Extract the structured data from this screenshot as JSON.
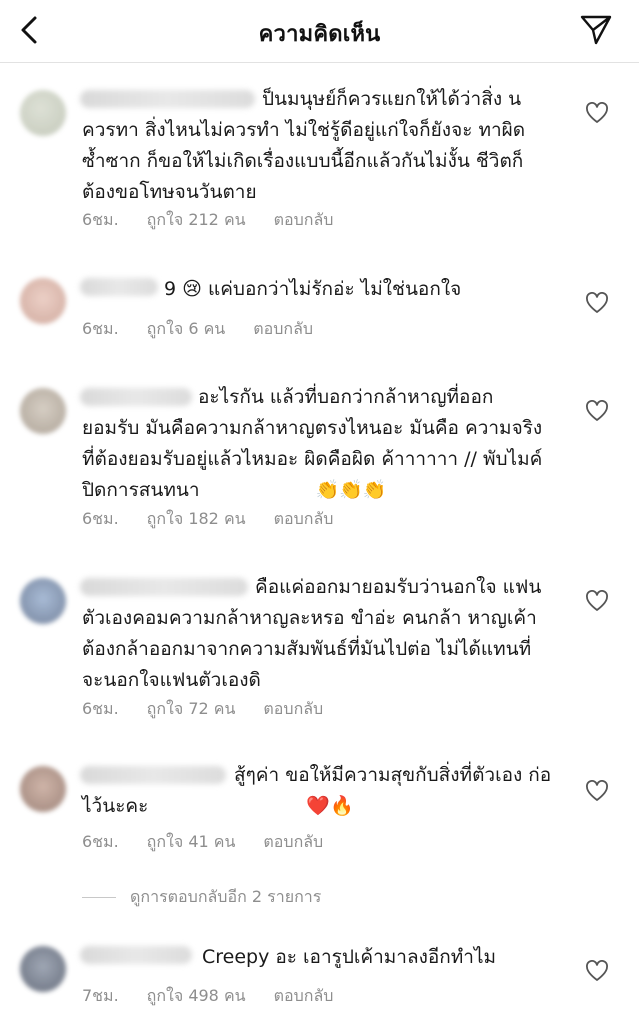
{
  "header": {
    "title": "ความคิดเห็น",
    "back_icon": "chevron-left-icon",
    "send_icon": "paper-plane-icon"
  },
  "labels": {
    "reply": "ตอบกลับ"
  },
  "comments": [
    {
      "text": "ป็นมนุษย์ก็ควรแยกให้ได้ว่าสิ่ง นควรทา สิ่งไหนไม่ควรทำ ไม่ใช่รู้ดีอยู่แก่ใจก็ยังจะ ทาผิดซ้ำซาก ก็ขอให้ไม่เกิดเรื่องแบบนี้อีกแล้วกันไม่งั้น ชีวิตก็ต้องขอโทษจนวันตาย",
      "time": "6ชม.",
      "likes": "ถูกใจ 212 คน"
    },
    {
      "text": "9 😢 แค่บอกว่าไม่รักอ่ะ ไม่ใช่นอกใจ",
      "time": "6ชม.",
      "likes": "ถูกใจ 6 คน"
    },
    {
      "text": "อะไรกัน แล้วที่บอกว่ากล้าหาญที่ออก ยอมรับ มันคือความกล้าหาญตรงไหนอะ มันคือ ความจริงที่ต้องยอมรับอยู่แล้วไหมอะ ผิดคือผิด ค้าาาาาา // พับไมค์ปิดการสนทนา",
      "emoji_suffix": "👏👏👏",
      "time": "6ชม.",
      "likes": "ถูกใจ 182 คน"
    },
    {
      "text": "คือแค่ออกมายอมรับว่านอกใจ แฟนตัวเองคอมความกล้าหาญละหรอ ขำอ่ะ คนกล้า หาญเค้าต้องกล้าออกมาจากความสัมพันธ์ที่มันไปต่อ ไม่ได้แทนที่จะนอกใจแฟนตัวเองดิ",
      "time": "6ชม.",
      "likes": "ถูกใจ 72 คน"
    },
    {
      "text": "สู้ๆค่า ขอให้มีความสุขกับสิ่งที่ตัวเอง ก่อไว้นะคะ",
      "emoji_suffix": "❤️🔥",
      "time": "6ชม.",
      "likes": "ถูกใจ 41 คน"
    },
    {
      "text": "Creepy อะ เอารูปเค้ามาลงอีกทำไม",
      "time": "7ชม.",
      "likes": "ถูกใจ 498 คน"
    }
  ],
  "view_replies": "ดูการตอบกลับอีก 2 รายการ",
  "colors": {
    "meta_gray": "#8e8e8e",
    "divider": "#e2e2e2"
  }
}
